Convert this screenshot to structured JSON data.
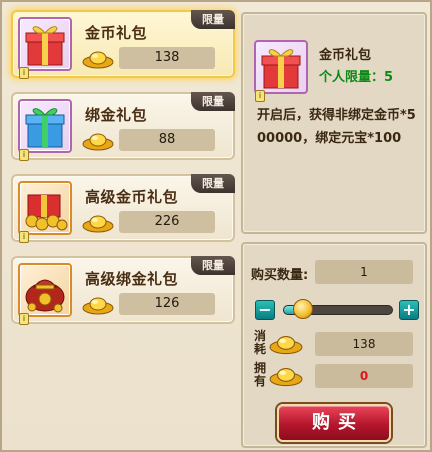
{
  "items": [
    {
      "name": "金币礼包",
      "price": "138",
      "tag": "限量",
      "lock": "i"
    },
    {
      "name": "绑金礼包",
      "price": "88",
      "tag": "限量",
      "lock": "i"
    },
    {
      "name": "高级金币礼包",
      "price": "226",
      "tag": "限量",
      "lock": "i"
    },
    {
      "name": "高级绑金礼包",
      "price": "126",
      "tag": "限量",
      "lock": "i"
    }
  ],
  "detail": {
    "name": "金币礼包",
    "limit": "个人限量：5",
    "description": "开启后，获得非绑定金币*500000，绑定元宝*100",
    "lock": "i"
  },
  "buy": {
    "quantity_label": "购买数量:",
    "quantity_value": "1",
    "minus": "−",
    "plus": "+",
    "slider_fraction": 0.18,
    "cost_label": "消耗",
    "cost_value": "138",
    "own_label": "拥有",
    "own_value": "0",
    "button_label": "购买"
  },
  "icons": {
    "gold": "gold-ingot-icon",
    "gift": "gift-box-icon"
  },
  "colors": {
    "limit_green": "#0d8a16",
    "own_red": "#e0141e",
    "buy_button": "#c0182e"
  }
}
